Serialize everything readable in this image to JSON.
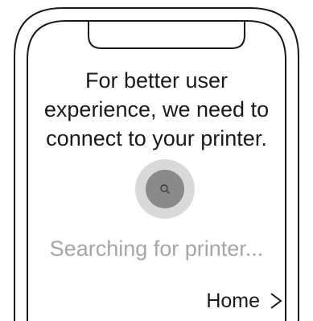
{
  "message": "For better user\nexperience, we need to\nconnect to your printer.",
  "status": "Searching for printer...",
  "home": {
    "label": "Home",
    "icon": "chevron-right-icon"
  },
  "spinner": {
    "icon": "search-icon"
  },
  "colors": {
    "text": "#1a1a1a",
    "muted": "#a6a6a6",
    "spinner_outer": "#d9d9d9",
    "spinner_inner": "#8a8a8a"
  }
}
